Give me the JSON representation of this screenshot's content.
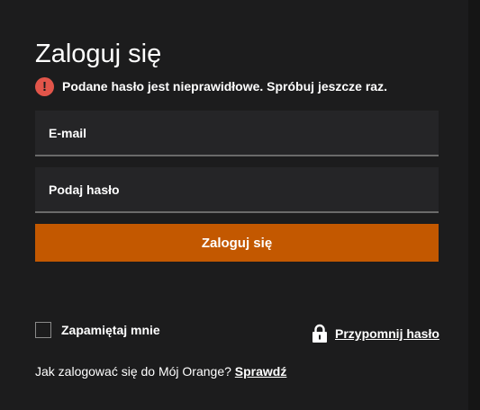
{
  "login": {
    "title": "Zaloguj się",
    "error_icon": "exclamation-circle-icon",
    "error_glyph": "!",
    "error_message": "Podane hasło jest nieprawidłowe. Spróbuj jeszcze raz.",
    "error_color": "#e2554a",
    "email_field": {
      "value": "",
      "placeholder": "E-mail"
    },
    "password_field": {
      "value": "",
      "placeholder": "Podaj hasło"
    },
    "submit_label": "Zaloguj się",
    "accent_color": "#c35800",
    "remember_me_label": "Zapamiętaj mnie",
    "remember_me_checked": false,
    "forgot_icon": "lock-icon",
    "forgot_password_label": "Przypomnij hasło",
    "help_text": "Jak zalogować się do Mój Orange?",
    "help_link_label": "Sprawdź"
  }
}
